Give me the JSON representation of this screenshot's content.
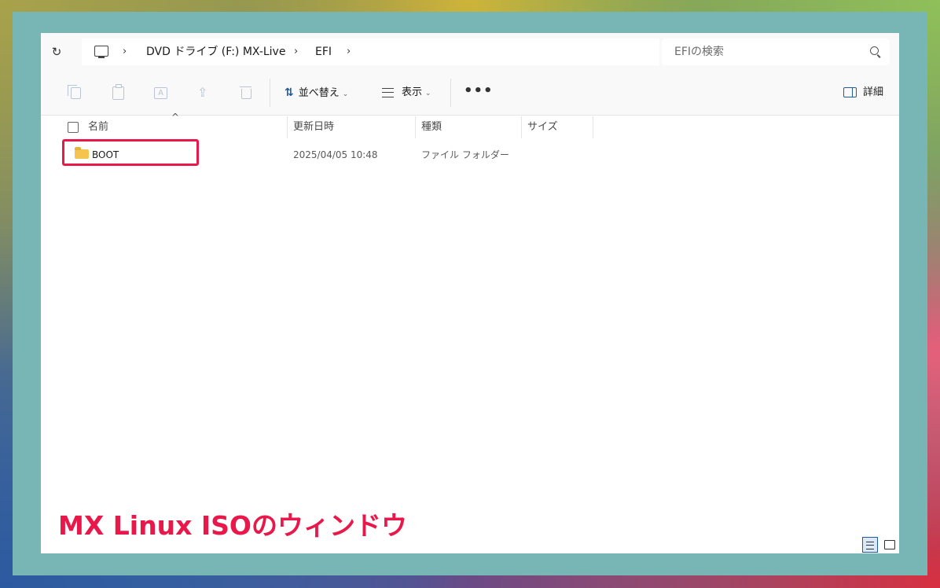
{
  "address_bar": {
    "refresh_icon": "refresh-icon",
    "breadcrumb": [
      "DVD ドライブ (F:) MX-Live",
      "EFI"
    ],
    "search_placeholder": "EFIの検索"
  },
  "toolbar": {
    "sort_label": "並べ替え",
    "view_label": "表示",
    "more_label": "•••",
    "details_label": "詳細"
  },
  "columns": {
    "name": "名前",
    "date": "更新日時",
    "type": "種類",
    "size": "サイズ"
  },
  "files": [
    {
      "name": "BOOT",
      "modified": "2025/04/05 10:48",
      "type": "ファイル フォルダー",
      "size": ""
    }
  ],
  "caption": "MX Linux ISOのウィンドウ",
  "colors": {
    "highlight": "#e8194a",
    "frame": "#78b6b6",
    "accent": "#1f5aa5"
  }
}
